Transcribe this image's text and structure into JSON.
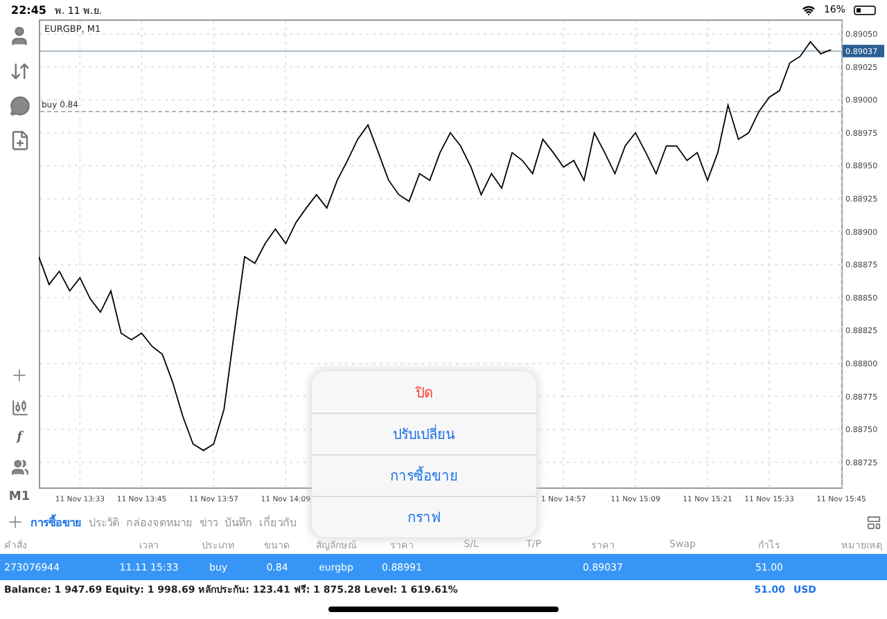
{
  "status_bar": {
    "time": "22:45",
    "date": "พ. 11 พ.ย.",
    "battery": "16%"
  },
  "left_toolbar": {
    "function_label": "f",
    "timeframe": "M1"
  },
  "chart": {
    "chart_data": {
      "type": "line",
      "title": "EURGBP, M1",
      "grid": true,
      "ylim": [
        0.88706,
        0.89061
      ],
      "categories": [
        null,
        null,
        null,
        null,
        "11 Nov 13:33",
        null,
        null,
        null,
        null,
        null,
        "11 Nov 13:45",
        null,
        null,
        null,
        null,
        null,
        null,
        "11 Nov 13:57",
        null,
        null,
        null,
        null,
        null,
        null,
        "11 Nov 14:09",
        null,
        null,
        null,
        null,
        null,
        null,
        null,
        null,
        null,
        null,
        null,
        null,
        null,
        null,
        null,
        null,
        null,
        null,
        null,
        null,
        null,
        null,
        null,
        null,
        null,
        null,
        "1 Nov 14:57",
        null,
        null,
        null,
        null,
        null,
        null,
        "11 Nov 15:09",
        null,
        null,
        null,
        null,
        null,
        null,
        "11 Nov 15:21",
        null,
        null,
        null,
        null,
        null,
        "11 Nov 15:33",
        null,
        null,
        null,
        null,
        null,
        null,
        "11 Nov 15:45"
      ],
      "yticks": [
        {
          "value": 0.8905,
          "label": "0.89050"
        },
        {
          "value": 0.89025,
          "label": "0.89025"
        },
        {
          "value": 0.89,
          "label": "0.89000"
        },
        {
          "value": 0.88975,
          "label": "0.88975"
        },
        {
          "value": 0.8895,
          "label": "0.88950"
        },
        {
          "value": 0.88925,
          "label": "0.88925"
        },
        {
          "value": 0.889,
          "label": "0.88900"
        },
        {
          "value": 0.88875,
          "label": "0.88875"
        },
        {
          "value": 0.8885,
          "label": "0.88850"
        },
        {
          "value": 0.88825,
          "label": "0.88825"
        },
        {
          "value": 0.888,
          "label": "0.88800"
        },
        {
          "value": 0.88775,
          "label": "0.88775"
        },
        {
          "value": 0.8875,
          "label": "0.88750"
        },
        {
          "value": 0.88725,
          "label": "0.88725"
        }
      ],
      "series": [
        {
          "color": "#000000",
          "values": [
            0.88881,
            0.8886,
            0.8887,
            0.88855,
            0.88865,
            0.88849,
            0.88839,
            0.88855,
            0.88823,
            0.88818,
            0.88823,
            0.88813,
            0.88807,
            0.88786,
            0.8876,
            0.88739,
            0.88734,
            0.88739,
            0.88765,
            0.88823,
            0.88881,
            0.88876,
            0.88891,
            0.88902,
            0.88891,
            0.88907,
            0.88918,
            0.88928,
            0.88918,
            0.88939,
            0.88954,
            0.8897,
            0.88981,
            0.8896,
            0.88939,
            0.88928,
            0.88923,
            0.88944,
            0.88939,
            0.8896,
            0.88975,
            0.88965,
            0.88949,
            0.88928,
            0.88944,
            0.88933,
            0.8896,
            0.88954,
            0.88944,
            0.8897,
            0.8896,
            0.88949,
            0.88954,
            0.88939,
            0.88975,
            0.8896,
            0.88944,
            0.88965,
            0.88975,
            0.8896,
            0.88944,
            0.88965,
            0.88965,
            0.88954,
            0.8896,
            0.88939,
            0.8896,
            0.88996,
            0.8897,
            0.88975,
            0.88991,
            0.89002,
            0.89007,
            0.89028,
            0.89033,
            0.89044,
            0.89035,
            0.89038,
            null
          ]
        }
      ],
      "ref_lines": [
        {
          "axis": "y",
          "value": 0.89037,
          "label": "0.89037"
        },
        {
          "axis": "y",
          "value": 0.88991,
          "label": "buy 0.84"
        }
      ]
    }
  },
  "tabs": [
    {
      "label": "การซื้อขาย",
      "selected": true
    },
    {
      "label": "ประวัติ",
      "selected": false
    },
    {
      "label": "กล่องจดหมาย",
      "selected": false
    },
    {
      "label": "ข่าว",
      "selected": false
    },
    {
      "label": "บันทึก",
      "selected": false
    },
    {
      "label": "เกี่ยวกับ",
      "selected": false
    }
  ],
  "table": {
    "columns": [
      "คำสั่ง",
      "เวลา",
      "ประเภท",
      "ขนาด",
      "สัญลักษณ์",
      "ราคา",
      "S/L",
      "T/P",
      "ราคา",
      "Swap",
      "กำไร",
      "หมายเหตุ"
    ],
    "rows": [
      {
        "selected": true,
        "cells": [
          "273076944",
          "11.11 15:33",
          "buy",
          "0.84",
          "eurgbp",
          "0.88991",
          null,
          null,
          "0.89037",
          null,
          "51.00",
          null
        ]
      }
    ]
  },
  "summary": {
    "text": "Balance: 1 947.69 Equity: 1 998.69 หลักประกัน: 123.41 ฟรี: 1 875.28 Level: 1 619.61%",
    "profit": "51.00",
    "currency": "USD"
  },
  "popup_menu": [
    {
      "label": "ปิด",
      "kind": "destructive"
    },
    {
      "label": "ปรับเปลี่ยน",
      "kind": "action"
    },
    {
      "label": "การซื้อขาย",
      "kind": "action"
    },
    {
      "label": "กราฟ",
      "kind": "action"
    }
  ]
}
